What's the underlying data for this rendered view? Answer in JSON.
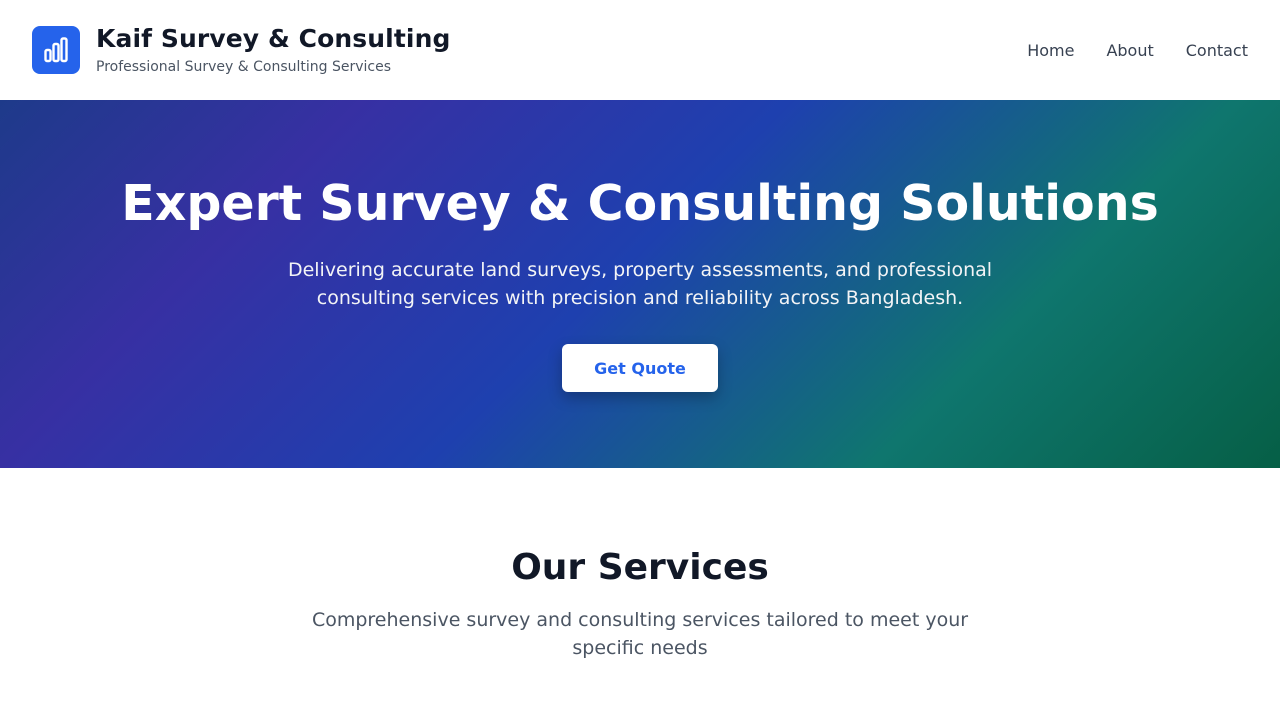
{
  "header": {
    "brand_name": "Kaif Survey & Consulting",
    "tagline": "Professional Survey & Consulting Services",
    "logo_icon": "bar-chart-icon",
    "accent_color": "#2563eb"
  },
  "nav": {
    "items": [
      {
        "label": "Home"
      },
      {
        "label": "About"
      },
      {
        "label": "Contact"
      }
    ]
  },
  "hero": {
    "title": "Expert Survey & Consulting Solutions",
    "description": "Delivering accurate land surveys, property assessments, and professional consulting services with precision and reliability across Bangladesh.",
    "cta_label": "Get Quote"
  },
  "services": {
    "title": "Our Services",
    "subtitle": "Comprehensive survey and consulting services tailored to meet your specific needs"
  }
}
